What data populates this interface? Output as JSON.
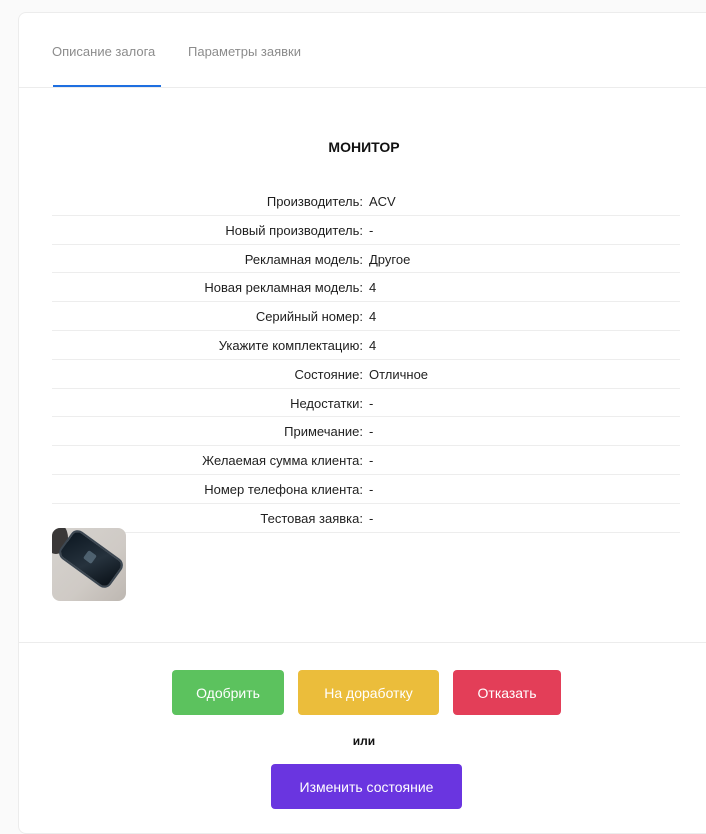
{
  "tabs": [
    {
      "label": "Описание залога",
      "active": true
    },
    {
      "label": "Параметры заявки",
      "active": false
    }
  ],
  "item_title": "МОНИТОР",
  "details": [
    {
      "label": "Производитель:",
      "value": "ACV"
    },
    {
      "label": "Новый производитель:",
      "value": "-"
    },
    {
      "label": "Рекламная модель:",
      "value": "Другое"
    },
    {
      "label": "Новая рекламная модель:",
      "value": "4"
    },
    {
      "label": "Серийный номер:",
      "value": "4"
    },
    {
      "label": "Укажите комплектацию:",
      "value": "4"
    },
    {
      "label": "Состояние:",
      "value": "Отличное"
    },
    {
      "label": "Недостатки:",
      "value": "-"
    },
    {
      "label": "Примечание:",
      "value": "-"
    },
    {
      "label": "Желаемая сумма клиента:",
      "value": "-"
    },
    {
      "label": "Номер телефона клиента:",
      "value": "-"
    },
    {
      "label": "Тестовая заявка:",
      "value": "-"
    }
  ],
  "actions": {
    "approve_label": "Одобрить",
    "revise_label": "На доработку",
    "reject_label": "Отказать",
    "or_label": "или",
    "change_state_label": "Изменить состояние"
  },
  "colors": {
    "active_tab_underline": "#1e6fe0",
    "approve": "#5cc25e",
    "revise": "#ebbd3b",
    "reject": "#e33e58",
    "change_state": "#6a35e0"
  }
}
